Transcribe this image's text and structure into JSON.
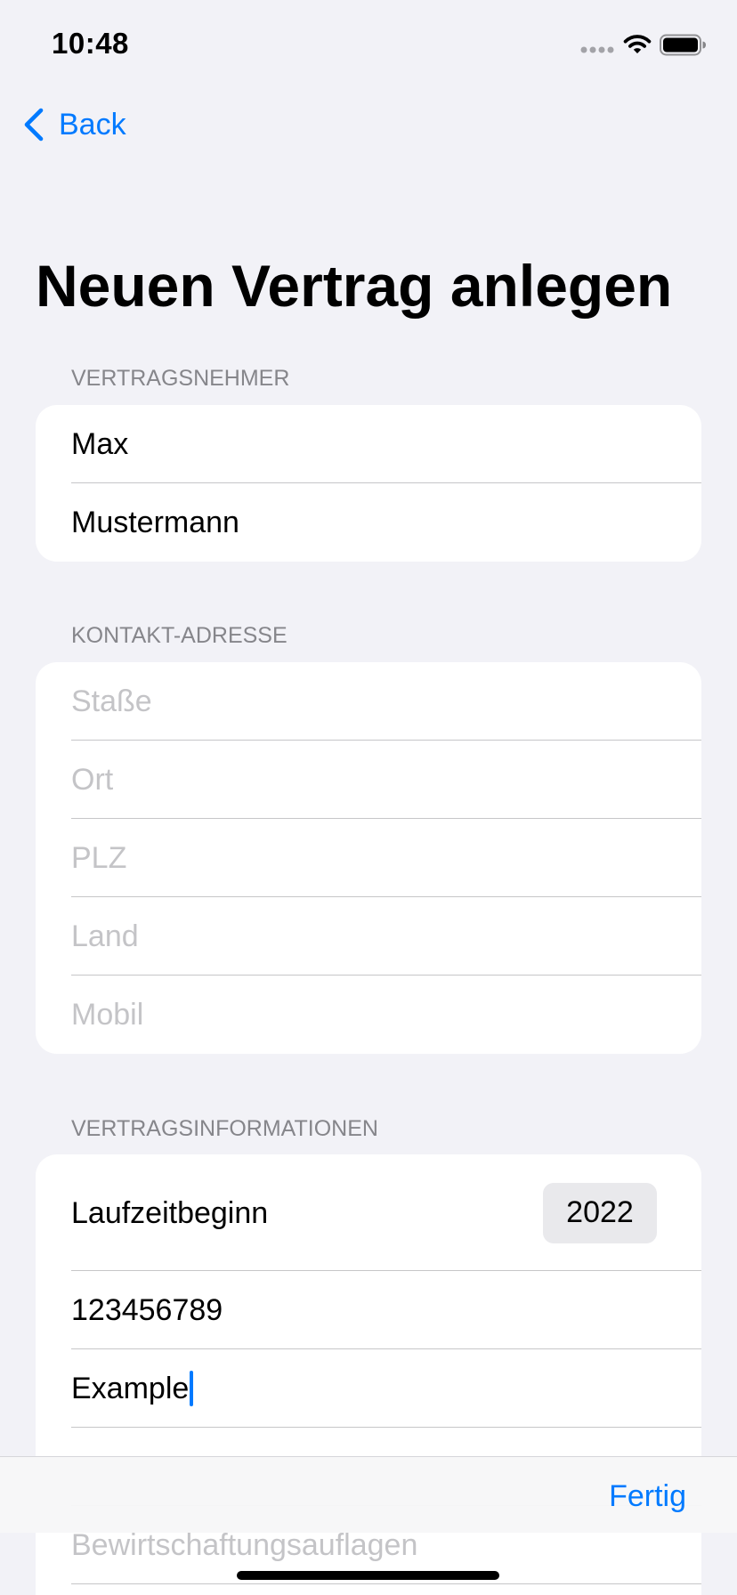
{
  "status_bar": {
    "time": "10:48",
    "icons": [
      "cellular-dots-icon",
      "wifi-icon",
      "battery-icon"
    ]
  },
  "nav": {
    "back_label": "Back",
    "back_icon": "chevron-left-icon"
  },
  "title": "Neuen Vertrag anlegen",
  "vertragsnehmer": {
    "header": "VERTRAGSNEHMER",
    "fields": [
      {
        "value": "Max"
      },
      {
        "value": "Mustermann"
      }
    ]
  },
  "kontakt": {
    "header": "KONTAKT-ADRESSE",
    "fields": [
      {
        "placeholder": "Staße"
      },
      {
        "placeholder": "Ort"
      },
      {
        "placeholder": "PLZ"
      },
      {
        "placeholder": "Land"
      },
      {
        "placeholder": "Mobil"
      }
    ]
  },
  "vertragsinformationen": {
    "header": "VERTRAGSINFORMATIONEN",
    "laufzeitbeginn": {
      "label": "Laufzeitbeginn",
      "value": "2022"
    },
    "fields": [
      {
        "value": "123456789"
      },
      {
        "value": "Example"
      },
      {
        "placeholder": "Bewirtschaftungsauflagen"
      }
    ]
  },
  "keyboard_toolbar": {
    "done_label": "Fertig"
  },
  "colors": {
    "accent": "#007AFF",
    "background": "#F2F2F7",
    "card": "#FFFFFF",
    "secondary_text": "#86868B",
    "placeholder": "#C4C4C7",
    "separator": "#C6C6C8"
  }
}
